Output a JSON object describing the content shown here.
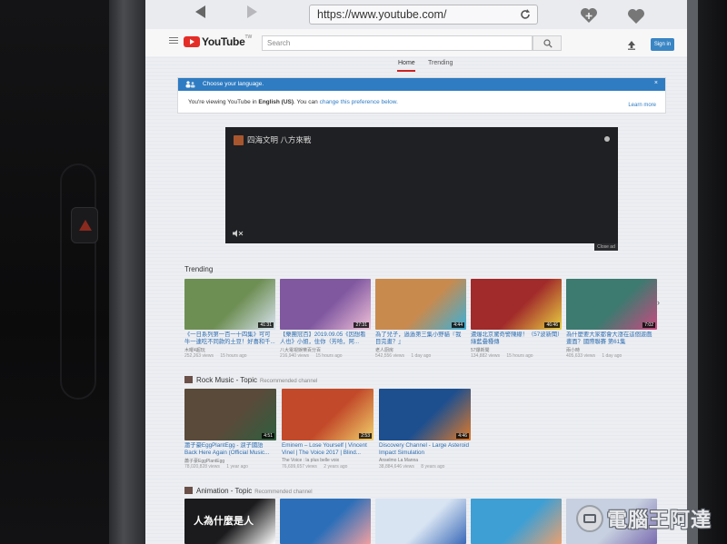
{
  "browser": {
    "url": "https://www.youtube.com/"
  },
  "header": {
    "logo_text": "YouTube",
    "logo_suffix": "TW",
    "search_placeholder": "Search",
    "signin_label": "Sign in"
  },
  "tabs": [
    {
      "label": "Home",
      "active": true
    },
    {
      "label": "Trending",
      "active": false
    }
  ],
  "language_banner": {
    "title": "Choose your language.",
    "close": "×",
    "msg_prefix": "You're viewing YouTube in ",
    "msg_language": "English (US)",
    "msg_middle": ". You can ",
    "msg_link": "change this preference below.",
    "learn_more": "Learn more"
  },
  "ad": {
    "channel_title": "四海文明 八方來戰",
    "close_label": "Close ad"
  },
  "trending": {
    "title": "Trending",
    "videos": [
      {
        "title": "《一日系列第一百一十四集》可可牛一連吃不同款的土豆！好喜和千...",
        "channel": "木曜4超玩",
        "views": "252,263 views",
        "age": "15 hours ago",
        "duration": "41:31",
        "color": "#6e8f54",
        "accent": "#d9e3f0"
      },
      {
        "title": "【樂團冠百】2019.09.05《因想看人也》小姐，住你（芳哈，阿...",
        "channel": "八大電視娛樂百分百",
        "views": "216,940 views",
        "age": "15 hours ago",
        "duration": "27:31",
        "color": "#8058a0",
        "accent": "#f0c0d8"
      },
      {
        "title": "為了兒子，過過第三集小野貓『我目完畫？』",
        "channel": "老人厨房",
        "views": "542,556 views",
        "age": "1 day ago",
        "duration": "4:44",
        "color": "#c98a4e",
        "accent": "#3bb0d8"
      },
      {
        "title": "遭爆北京驚奇警陳線！（57波新聞）綠藍疊種傳",
        "channel": "57爆新聞",
        "views": "134,882 views",
        "age": "15 hours ago",
        "duration": "46:46",
        "color": "#a12a2a",
        "accent": "#e8d040"
      },
      {
        "title": "為什麼要大家都會大漲在這個遊戲畫面？國際聯賽 第61集",
        "channel": "兩小時",
        "views": "405,633 views",
        "age": "1 day ago",
        "duration": "7:02",
        "color": "#3d7a70",
        "accent": "#c94a80"
      }
    ]
  },
  "rock": {
    "title": "Rock Music - Topic",
    "subtitle": "Recommended channel",
    "videos": [
      {
        "title": "蕭子豪EggPlantEgg - 淚子國語 Back Here Again (Official Music...",
        "channel": "蕭子豪EggPlantEgg",
        "views": "78,020,828 views",
        "age": "1 year ago",
        "duration": "4:51",
        "color": "#5a4a3a",
        "accent": "#2e5f3f"
      },
      {
        "title": "Eminem – Lose Yourself | Vincent Vinel | The Voice 2017 | Blind...",
        "channel": "The Voice : la plus belle voix",
        "views": "76,699,657 views",
        "age": "2 years ago",
        "duration": "2:53",
        "color": "#c24a2a",
        "accent": "#f0d06a"
      },
      {
        "title": "Discovery Channel - Large Asteroid Impact Simulation",
        "channel": "Anselmo La Manna",
        "views": "38,884,646 views",
        "age": "8 years ago",
        "duration": "4:46",
        "color": "#1d4f8f",
        "accent": "#e07a2a"
      }
    ]
  },
  "animation": {
    "title": "Animation - Topic",
    "subtitle": "Recommended channel",
    "videos": [
      {
        "caption": "人為什麼是人",
        "color": "#1b1b1d",
        "accent": "#ffffff"
      },
      {
        "caption": "",
        "color": "#2c6fb8",
        "accent": "#f0a0a0"
      },
      {
        "caption": "",
        "color": "#d8e4f2",
        "accent": "#3a6ab8"
      },
      {
        "caption": "",
        "color": "#3e9fd4",
        "accent": "#e8a070"
      },
      {
        "caption": "",
        "color": "#c7d0e0",
        "accent": "#7a6cb0"
      }
    ]
  },
  "watermark": {
    "text": "電腦王阿達"
  }
}
